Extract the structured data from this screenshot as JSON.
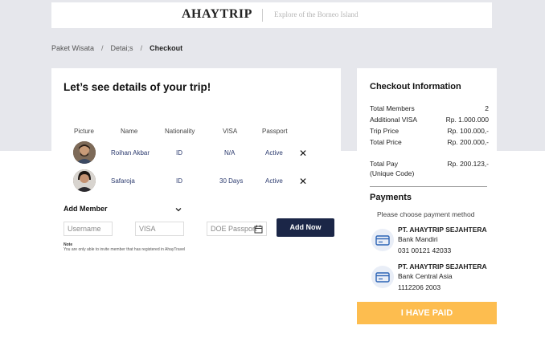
{
  "header": {
    "brand": "AHAYTRIP",
    "tagline": "Explore of the Borneo Island"
  },
  "breadcrumb": {
    "items": [
      "Paket Wisata",
      "Detai;s",
      "Checkout"
    ],
    "separator": "/"
  },
  "trip": {
    "title": "Let’s see details of your trip!",
    "columns": [
      "Picture",
      "Name",
      "Nationality",
      "VISA",
      "Passport"
    ],
    "members": [
      {
        "name": "Roihan Akbar",
        "nationality": "ID",
        "visa": "N/A",
        "passport": "Active",
        "remove": "✕"
      },
      {
        "name": "Safaroja",
        "nationality": "ID",
        "visa": "30 Days",
        "passport": "Active",
        "remove": "✕"
      }
    ],
    "add_member_label": "Add Member",
    "form": {
      "username_placeholder": "Username",
      "visa_placeholder": "VISA",
      "doe_placeholder": "DOE Passport",
      "add_button": "Add Now"
    },
    "note_title": "Note",
    "note_text": "You are only able to invite member that has registered in AhayTravel"
  },
  "checkout": {
    "title": "Checkout Information",
    "rows": [
      {
        "label": "Total Members",
        "value": "2"
      },
      {
        "label": "Additional VISA",
        "value": "Rp. 1.000.000"
      },
      {
        "label": "Trip Price",
        "value": "Rp. 100.000,-"
      },
      {
        "label": "Total Price",
        "value": "Rp. 200.000,-"
      }
    ],
    "total_pay_label_1": "Total Pay",
    "total_pay_label_2": "(Unique Code)",
    "total_pay_value": "Rp. 200.123,-"
  },
  "payments": {
    "title": "Payments",
    "subtitle": "Please choose payment method",
    "banks": [
      {
        "company": "PT. AHAYTRIP SEJAHTERA",
        "bank": "Bank Mandiri",
        "account": "031 00121 42033"
      },
      {
        "company": "PT. AHAYTRIP SEJAHTERA",
        "bank": "Bank Central Asia",
        "account": "1112206 2003"
      }
    ],
    "paid_button": "I HAVE PAID"
  },
  "colors": {
    "navy": "#1b2647",
    "accent": "#fdbd4f",
    "background": "#e6e7ec",
    "link": "#2b3a6e"
  }
}
